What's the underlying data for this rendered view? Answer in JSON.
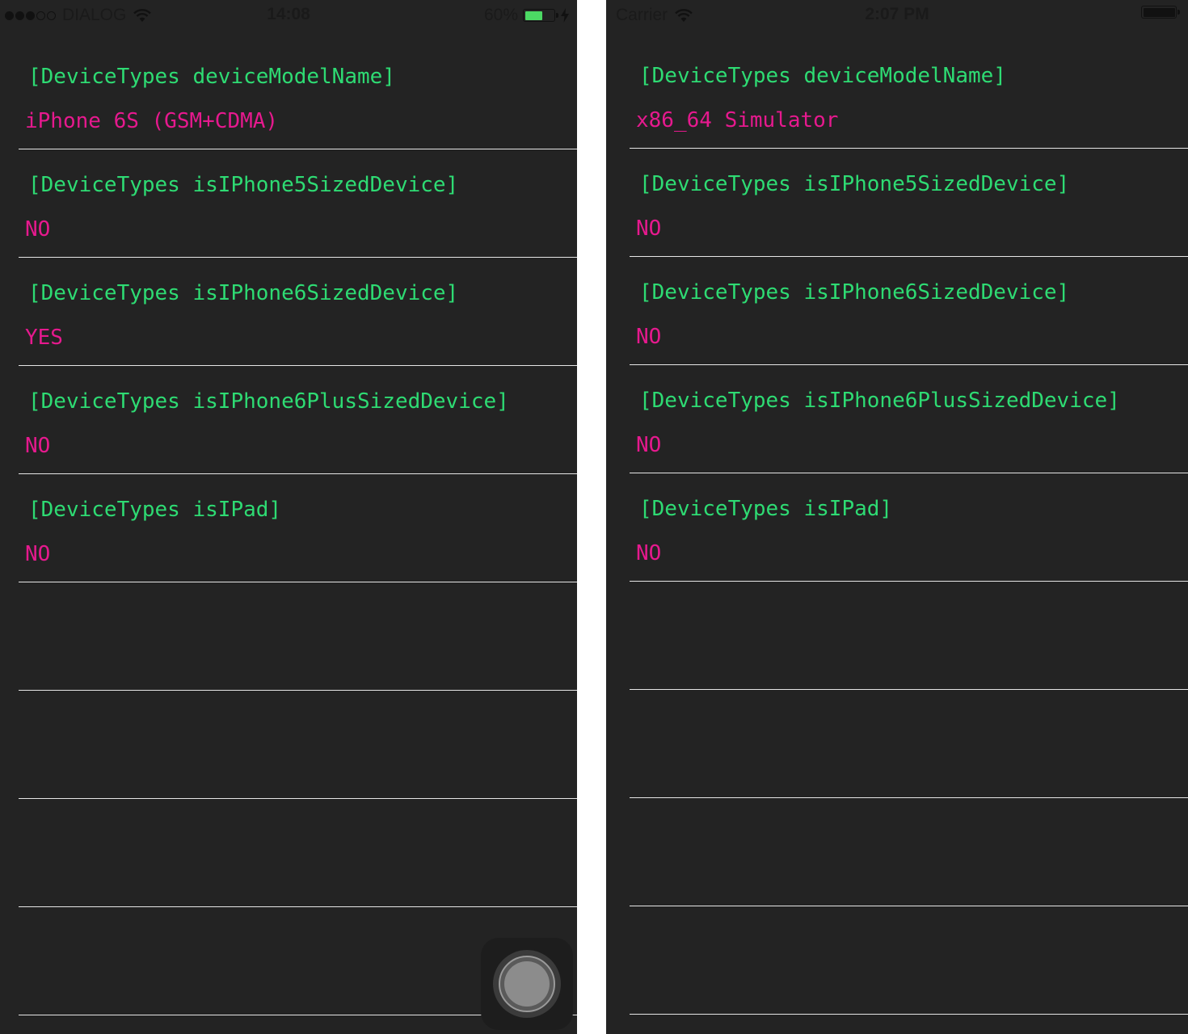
{
  "colors": {
    "background": "#232323",
    "label": "#2edb73",
    "value": "#e6198e",
    "divider": "#e6e6e6",
    "battery_green": "#4cd964"
  },
  "left": {
    "status": {
      "carrier": "DIALOG",
      "time": "14:08",
      "battery": "60%",
      "battery_level": 0.6,
      "signal_bars": 3,
      "icons": [
        "signal-dots-icon",
        "wifi-icon",
        "battery-icon",
        "charging-bolt-icon"
      ]
    },
    "rows": [
      {
        "label": "[DeviceTypes deviceModelName]",
        "value": "iPhone 6S (GSM+CDMA)"
      },
      {
        "label": "[DeviceTypes isIPhone5SizedDevice]",
        "value": "NO"
      },
      {
        "label": "[DeviceTypes isIPhone6SizedDevice]",
        "value": "YES"
      },
      {
        "label": "[DeviceTypes isIPhone6PlusSizedDevice]",
        "value": "NO"
      },
      {
        "label": "[DeviceTypes isIPad]",
        "value": "NO"
      },
      {
        "label": "",
        "value": ""
      },
      {
        "label": "",
        "value": ""
      },
      {
        "label": "",
        "value": ""
      },
      {
        "label": "",
        "value": ""
      }
    ]
  },
  "right": {
    "status": {
      "carrier": "Carrier",
      "time": "2:07 PM",
      "battery_level": 1.0,
      "icons": [
        "wifi-icon",
        "battery-icon"
      ]
    },
    "rows": [
      {
        "label": "[DeviceTypes deviceModelName]",
        "value": "x86_64 Simulator"
      },
      {
        "label": "[DeviceTypes isIPhone5SizedDevice]",
        "value": "NO"
      },
      {
        "label": "[DeviceTypes isIPhone6SizedDevice]",
        "value": "NO"
      },
      {
        "label": "[DeviceTypes isIPhone6PlusSizedDevice]",
        "value": "NO"
      },
      {
        "label": "[DeviceTypes isIPad]",
        "value": "NO"
      },
      {
        "label": "",
        "value": ""
      },
      {
        "label": "",
        "value": ""
      },
      {
        "label": "",
        "value": ""
      },
      {
        "label": "",
        "value": ""
      }
    ]
  }
}
